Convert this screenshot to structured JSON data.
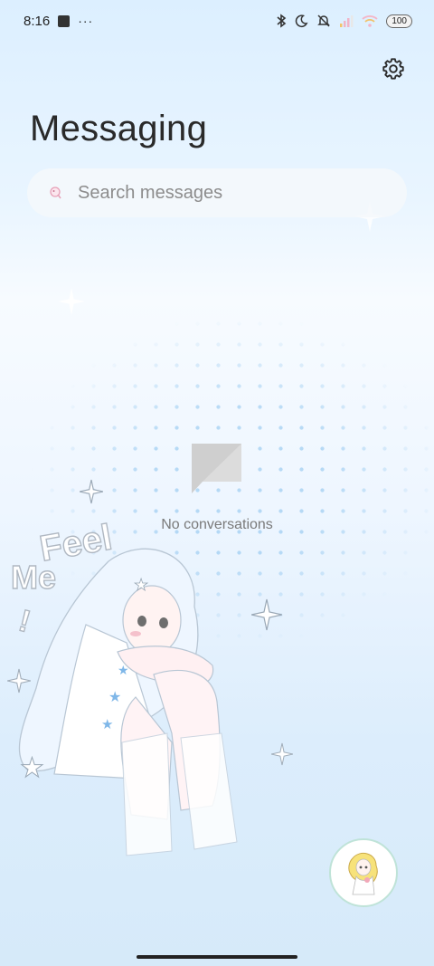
{
  "status_bar": {
    "time": "8:16",
    "more": "···",
    "battery": "100",
    "icons": [
      "app-notification-icon",
      "bluetooth-icon",
      "moon-icon",
      "bell-muted-icon",
      "signal-icon",
      "wifi-icon",
      "battery-icon"
    ]
  },
  "header": {
    "title": "Messaging",
    "settings_icon": "gear-icon"
  },
  "search": {
    "placeholder": "Search messages",
    "icon": "search-icon"
  },
  "empty_state": {
    "icon": "chat-bubble-icon",
    "text": "No conversations"
  },
  "decoration": {
    "text_feel": "Feel",
    "text_me": "Me",
    "text_excl": "!"
  },
  "fab": {
    "icon": "compose-avatar-icon"
  },
  "colors": {
    "accent": "#5aaae6",
    "background_top": "#dcefff",
    "title": "#2a2a2a"
  }
}
